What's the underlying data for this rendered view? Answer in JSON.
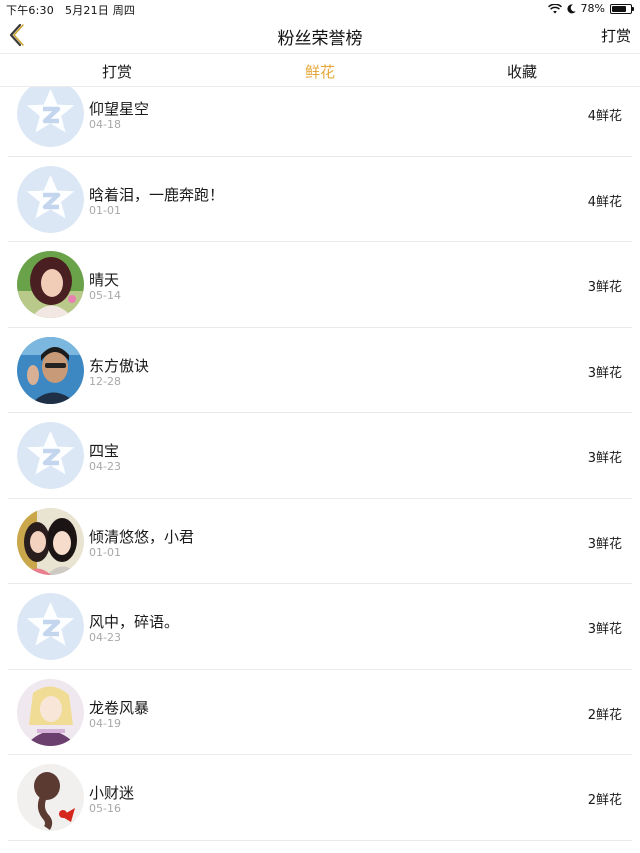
{
  "status_bar": {
    "time": "下午6:30",
    "date": "5月21日 周四",
    "battery": "78%",
    "battery_level": 0.78
  },
  "nav": {
    "title": "粉丝荣誉榜",
    "right_label": "打赏",
    "back_icon": "chevron-left-icon"
  },
  "tabs": [
    {
      "label": "打赏",
      "active": false
    },
    {
      "label": "鲜花",
      "active": true
    },
    {
      "label": "收藏",
      "active": false
    }
  ],
  "colors": {
    "accent": "#e5a83a",
    "divider": "#e9e9e9",
    "date_text": "#a8a8a8",
    "default_avatar": "#dbe7f5"
  },
  "rows": [
    {
      "name": "仰望星空",
      "date": "04-18",
      "score": "4鲜花",
      "avatar": "default"
    },
    {
      "name": "晗着泪，一鹿奔跑！",
      "date": "01-01",
      "score": "4鲜花",
      "avatar": "default"
    },
    {
      "name": "晴天",
      "date": "05-14",
      "score": "3鲜花",
      "avatar": "photo-woman"
    },
    {
      "name": "东方傲诀",
      "date": "12-28",
      "score": "3鲜花",
      "avatar": "photo-man"
    },
    {
      "name": "四宝",
      "date": "04-23",
      "score": "3鲜花",
      "avatar": "default"
    },
    {
      "name": "倾清悠悠，小君",
      "date": "01-01",
      "score": "3鲜花",
      "avatar": "photo-two-girls"
    },
    {
      "name": "风中，碎语。",
      "date": "04-23",
      "score": "3鲜花",
      "avatar": "default"
    },
    {
      "name": "龙卷风暴",
      "date": "04-19",
      "score": "2鲜花",
      "avatar": "photo-anime"
    },
    {
      "name": "小财迷",
      "date": "05-16",
      "score": "2鲜花",
      "avatar": "photo-braid"
    }
  ]
}
